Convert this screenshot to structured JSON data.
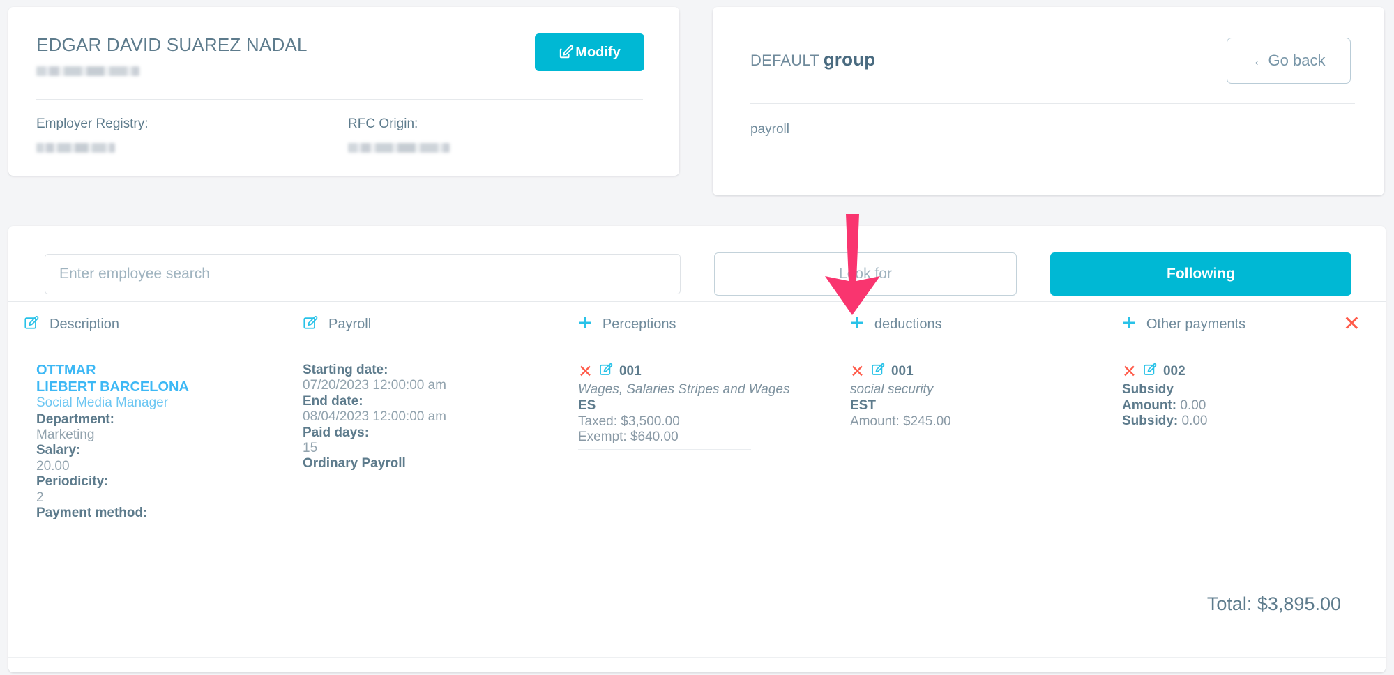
{
  "employee_card": {
    "name": "EDGAR DAVID SUAREZ NADAL",
    "subtitle_redacted": "",
    "modify_button": "Modify",
    "modify_icon": "edit-pencil-square-icon",
    "fields": [
      {
        "label": "Employer Registry:",
        "value_redacted": ""
      },
      {
        "label": "RFC Origin:",
        "value_redacted": ""
      }
    ]
  },
  "group_card": {
    "title_prefix": "DEFAULT ",
    "title_strong": "group",
    "go_back_button": "Go back",
    "go_back_icon": "arrow-left-icon",
    "body_text": "payroll"
  },
  "toolbar": {
    "search_placeholder": "Enter employee search",
    "search_value": "",
    "look_for_button": "Look for",
    "following_button": "Following"
  },
  "table": {
    "columns": [
      {
        "label": "Description",
        "icon": "edit-pencil-square-icon"
      },
      {
        "label": "Payroll",
        "icon": "edit-pencil-square-icon"
      },
      {
        "label": "Perceptions",
        "icon": "plus-icon"
      },
      {
        "label": "deductions",
        "icon": "plus-icon"
      },
      {
        "label": "Other payments",
        "icon": "plus-icon"
      }
    ],
    "close_row_icon": "close-x-icon",
    "row": {
      "description": {
        "employee_name_line1": "OTTMAR",
        "employee_name_line2": "LIEBERT BARCELONA",
        "role": "Social Media Manager",
        "fields": [
          {
            "label": "Department:",
            "value": "Marketing"
          },
          {
            "label": "Salary:",
            "value": "20.00"
          },
          {
            "label": "Periodicity:",
            "value": "2"
          },
          {
            "label": "Payment method:",
            "value": ""
          }
        ]
      },
      "payroll": {
        "fields": [
          {
            "label": "Starting date:",
            "value": "07/20/2023 12:00:00 am"
          },
          {
            "label": "End date:",
            "value": "08/04/2023 12:00:00 am"
          },
          {
            "label": "Paid days:",
            "value": "15"
          }
        ],
        "type": "Ordinary Payroll"
      },
      "perceptions": [
        {
          "code": "001",
          "description": "Wages, Salaries Stripes and Wages",
          "subcode": "ES",
          "amounts": [
            {
              "label": "Taxed:",
              "value": "$3,500.00"
            },
            {
              "label": "Exempt:",
              "value": "$640.00"
            }
          ]
        }
      ],
      "deductions": [
        {
          "code": "001",
          "description": "social security",
          "subcode": "EST",
          "amounts": [
            {
              "label": "Amount:",
              "value": "$245.00"
            }
          ]
        }
      ],
      "other_payments": [
        {
          "code": "002",
          "description": "Subsidy",
          "amounts": [
            {
              "label": "Amount:",
              "value": "0.00"
            },
            {
              "label": "Subsidy:",
              "value": "0.00"
            }
          ]
        }
      ]
    },
    "total_label": "Total: $3,895.00"
  },
  "annotation": {
    "arrow_color": "#f9356f",
    "arrow_target": "deductions-add-icon"
  },
  "colors": {
    "accent": "#00b8d4",
    "icon_cyan": "#29c2e8",
    "text_slate": "#5d7b8c",
    "muted": "#8a9aa6",
    "link_blue": "#3db8f5",
    "danger": "#ff5b4a",
    "page_bg": "#f4f5f7"
  }
}
